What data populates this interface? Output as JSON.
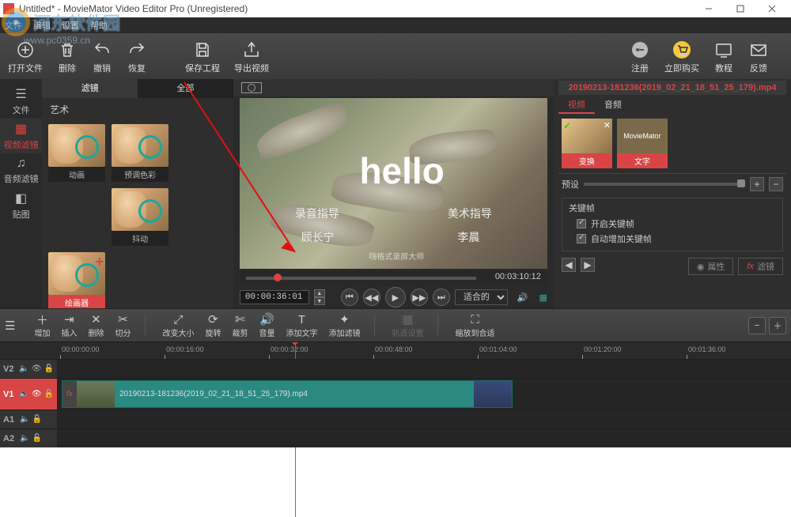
{
  "title": "Untitled* - MovieMator Video Editor Pro (Unregistered)",
  "menu": [
    "文件",
    "编辑",
    "设置",
    "帮助"
  ],
  "watermark": {
    "name": "河东软件园",
    "url": "www.pc0359.cn"
  },
  "toolbar": {
    "open": "打开文件",
    "delete": "删除",
    "undo": "撤销",
    "redo": "恢复",
    "save": "保存工程",
    "export": "导出视频",
    "register": "注册",
    "buy": "立即购买",
    "tutorial": "教程",
    "feedback": "反馈"
  },
  "sidebar": {
    "file": "文件",
    "vfilter": "视频滤镜",
    "afilter": "音频滤镜",
    "sticker": "贴图"
  },
  "filters": {
    "tab_filter": "滤镜",
    "tab_all": "全部",
    "category": "艺术",
    "items": [
      "动画",
      "预调色彩",
      "抖动",
      "绘画器",
      "",
      ""
    ]
  },
  "preview": {
    "hello": "hello",
    "credit1": "录音指导",
    "credit2": "美术指导",
    "name1": "顾长宁",
    "name2": "李晨",
    "watermark": "嗨格式录屏大师",
    "duration": "00:03:10:12",
    "timecode": "00:00:36:01",
    "fit": "适合的"
  },
  "props": {
    "clip": "20190213-181236(2019_02_21_18_51_25_179).mp4",
    "tab_video": "视频",
    "tab_audio": "音频",
    "filter_transform": "变换",
    "filter_text": "文字",
    "preset": "预设",
    "keyframe_title": "关键帧",
    "kf_enable": "开启关键帧",
    "kf_auto": "自动增加关键帧",
    "attr": "属性",
    "fx": "滤镜"
  },
  "tltoolbar": {
    "menu": "菜单",
    "add": "增加",
    "insert": "插入",
    "delete": "删除",
    "split": "切分",
    "resize": "改变大小",
    "rotate": "旋转",
    "crop": "裁剪",
    "volume": "音量",
    "addtext": "添加文字",
    "addfilter": "添加滤镜",
    "tracksettings": "轨道设置",
    "fitwindow": "缩放到合适"
  },
  "ruler": {
    "ticks": [
      "00:00:00:00",
      "00:00:16:00",
      "00:00:32:00",
      "00:00:48:00",
      "00:01:04:00",
      "00:01:20:00",
      "00:01:36:00"
    ]
  },
  "tracks": {
    "v2": "V2",
    "v1": "V1",
    "a1": "A1",
    "a2": "A2",
    "clipname": "20190213-181236(2019_02_21_18_51_25_179).mp4"
  }
}
